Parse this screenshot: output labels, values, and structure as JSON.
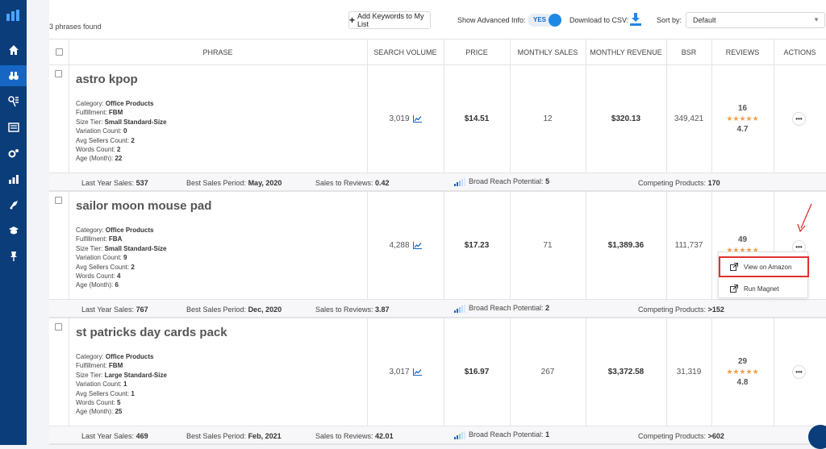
{
  "toolbar": {
    "phrases_found": "3 phrases found",
    "add_keywords_label": "Add Keywords to My List",
    "show_advanced_label": "Show Advanced Info:",
    "advanced_toggle": "YES",
    "download_label": "Download to CSV:",
    "sort_label": "Sort by:",
    "sort_value": "Default"
  },
  "table_headers": [
    "PHRASE",
    "SEARCH VOLUME",
    "PRICE",
    "MONTHLY SALES",
    "MONTHLY REVENUE",
    "BSR",
    "REVIEWS",
    "ACTIONS"
  ],
  "detail_labels": [
    "Category:",
    "Fulfillment:",
    "Size Tier:",
    "Variation Count:",
    "Avg Sellers Count:",
    "Words Count:",
    "Age (Month):"
  ],
  "footer_labels": [
    "Last Year Sales:",
    "Best Sales Period:",
    "Sales to Reviews:",
    "Broad Reach Potential:",
    "Competing Products:"
  ],
  "rows": [
    {
      "phrase": "astro kpop",
      "details": [
        "Office Products",
        "FBM",
        "Small Standard-Size",
        "0",
        "2",
        "2",
        "22"
      ],
      "search_volume": "3,019",
      "price": "$14.51",
      "monthly_sales": "12",
      "monthly_revenue": "$320.13",
      "bsr": "349,421",
      "reviews": "16",
      "stars": "★★★★★",
      "rating": "4.7",
      "footer": [
        "537",
        "May, 2020",
        "0.42",
        "5",
        "170"
      ]
    },
    {
      "phrase": "sailor moon mouse pad",
      "details": [
        "Office Products",
        "FBA",
        "Small Standard-Size",
        "9",
        "2",
        "4",
        "6"
      ],
      "search_volume": "4,288",
      "price": "$17.23",
      "monthly_sales": "71",
      "monthly_revenue": "$1,389.36",
      "bsr": "111,737",
      "reviews": "49",
      "stars": "★★★★★",
      "rating": "",
      "footer": [
        "767",
        "Dec, 2020",
        "3.87",
        "2",
        ">152"
      ]
    },
    {
      "phrase": "st patricks day cards pack",
      "details": [
        "Office Products",
        "FBM",
        "Large Standard-Size",
        "1",
        "1",
        "5",
        "25"
      ],
      "search_volume": "3,017",
      "price": "$16.97",
      "monthly_sales": "267",
      "monthly_revenue": "$3,372.58",
      "bsr": "31,319",
      "reviews": "29",
      "stars": "★★★★★",
      "rating": "4.8",
      "footer": [
        "469",
        "Feb, 2021",
        "42.01",
        "1",
        ">602"
      ]
    }
  ],
  "actions_menu": {
    "view_on_amazon": "View on Amazon",
    "run_magnet": "Run Magnet"
  },
  "colors": {
    "sidebar": "#0a3d7a",
    "accent": "#1766c4",
    "stars": "#f0a04b",
    "highlight": "#e03030"
  }
}
